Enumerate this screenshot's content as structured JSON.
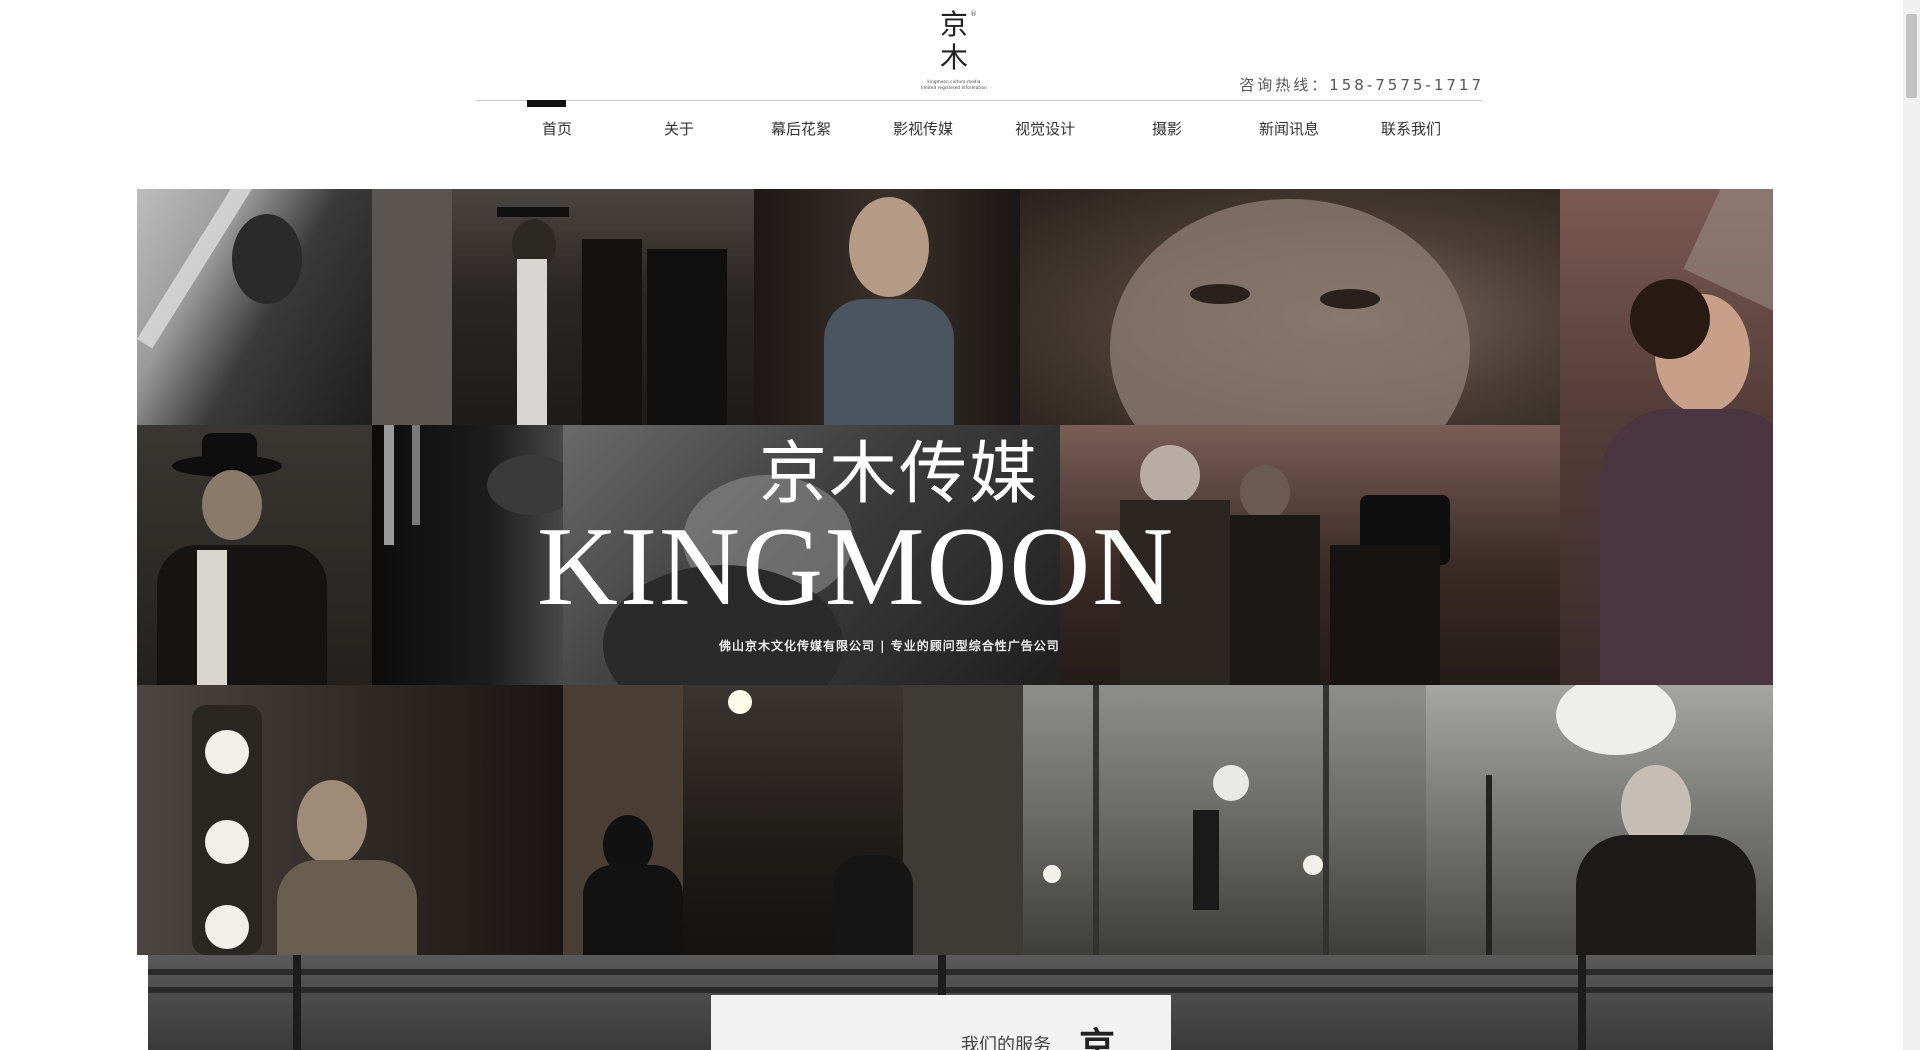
{
  "header": {
    "logo": {
      "char1": "京",
      "char2": "木",
      "registered": "®",
      "subtitle1": "kingmoon culture media",
      "subtitle2": "limited registered information"
    },
    "hotline": "咨询热线：158-7575-1717"
  },
  "nav": {
    "items": [
      "首页",
      "关于",
      "幕后花絮",
      "影视传媒",
      "视觉设计",
      "摄影",
      "新闻讯息",
      "联系我们"
    ],
    "active_index": 0
  },
  "banner": {
    "title_cn": "京木传媒",
    "title_en": "KINGMOON",
    "tagline": "佛山京木文化传媒有限公司 | 专业的顾问型综合性广告公司"
  },
  "services": {
    "label": "我们的服务",
    "char": "京"
  },
  "colors": {
    "nav_active": "#111111",
    "rule": "#c9c9c9",
    "banner_text": "#ffffff"
  }
}
